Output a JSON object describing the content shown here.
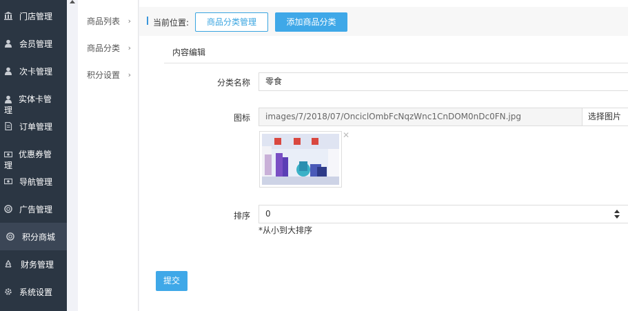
{
  "sidebar": {
    "items": [
      {
        "label": "门店管理",
        "icon": "bank-icon"
      },
      {
        "label": "会员管理",
        "icon": "user-icon"
      },
      {
        "label": "次卡管理",
        "icon": "user-icon"
      },
      {
        "label": "实体卡管理",
        "icon": "user-icon"
      },
      {
        "label": "订单管理",
        "icon": "document-icon"
      },
      {
        "label": "优惠券管理",
        "icon": "money-icon"
      },
      {
        "label": "导航管理",
        "icon": "money-icon"
      },
      {
        "label": "广告管理",
        "icon": "lifebuoy-icon"
      },
      {
        "label": "积分商城",
        "icon": "lifebuoy-icon"
      },
      {
        "label": "财务管理",
        "icon": "recycle-icon"
      },
      {
        "label": "系统设置",
        "icon": "gear-icon"
      }
    ],
    "active": "积分商城"
  },
  "submenu": {
    "items": [
      {
        "label": "商品列表"
      },
      {
        "label": "商品分类"
      },
      {
        "label": "积分设置"
      }
    ]
  },
  "header": {
    "crumb_label": "当前位置:",
    "crumb_button": "商品分类管理",
    "add_button": "添加商品分类"
  },
  "panel": {
    "title": "内容编辑"
  },
  "form": {
    "name_label": "分类名称",
    "name_value": "零食",
    "icon_label": "图标",
    "icon_path": "images/7/2018/07/OnciclOmbFcNqzWnc1CnDOM0nDc0FN.jpg",
    "choose_image_label": "选择图片",
    "sort_label": "排序",
    "sort_value": "0",
    "sort_hint": "*从小到大排序",
    "submit_label": "提交"
  },
  "colors": {
    "sidebar_bg": "#2b3643",
    "accent": "#3fa8e8"
  }
}
